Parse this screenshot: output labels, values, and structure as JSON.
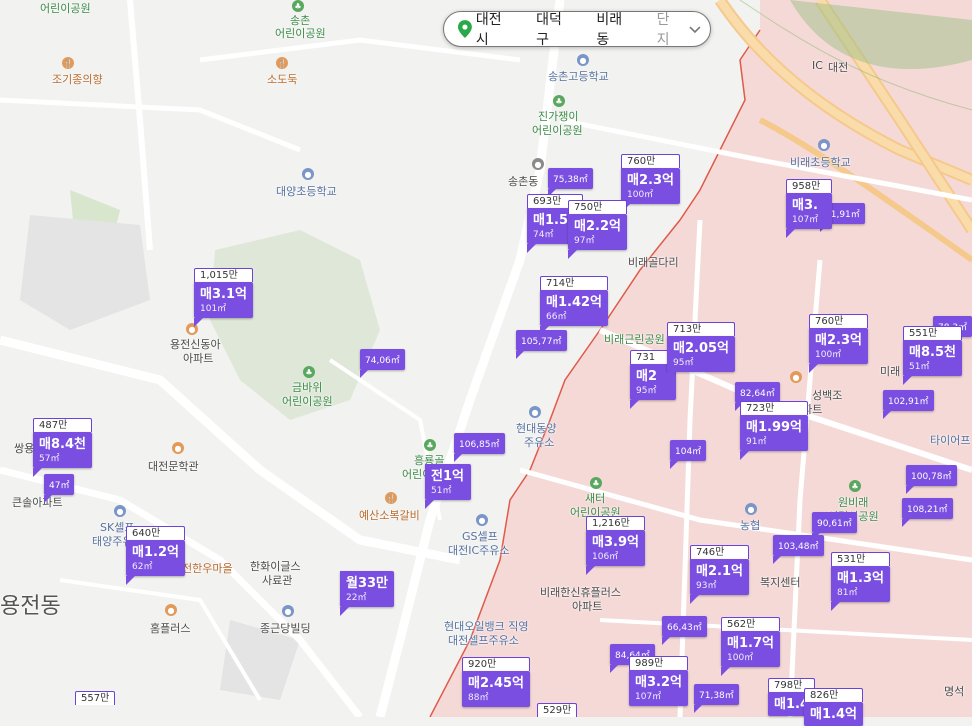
{
  "breadcrumb": {
    "city": "대전시",
    "district": "대덕구",
    "dong": "비래동",
    "complex_placeholder": "단지"
  },
  "places": {
    "p1": "어린이공원",
    "p2": "송촌",
    "p3": "어린이공원",
    "p4": "조기종의향",
    "p5": "소도둑",
    "p6": "송촌고등학교",
    "p7": "진가쟁이",
    "p8": "어린이공원",
    "p9": "대양초등학교",
    "p10": "송촌동",
    "p11": "비래초등학교",
    "p12": "대전",
    "p13": "용전신동아",
    "p14": "아파트",
    "p15": "금바위",
    "p16": "어린이공원",
    "p17": "대전문학관",
    "p18": "비래골다리",
    "p19": "비래근린공원",
    "p20": "현대동양",
    "p21": "주유소",
    "p22": "흥룡골",
    "p23": "어린이",
    "p24": "예산소복갈비",
    "p25": "GS셀프",
    "p26": "대전IC주유소",
    "p27": "새터",
    "p28": "어린이공원",
    "p29": "농협",
    "p30": "원비래",
    "p31": "어린이공원",
    "p32": "비래한신휴플러스",
    "p33": "아파트",
    "p34": "SK셀프",
    "p35": "태양주유소",
    "p36": "한화이글스",
    "p37": "사료관",
    "p38": "종근당빌딩",
    "p39": "홈플러스",
    "p40": "용전동",
    "p41": "현대오일뱅크 직영",
    "p42": "대전셀프주유소",
    "p43": "성백조",
    "p44": "아파트",
    "p45": "미래",
    "p46": "타이어프",
    "p47": "쌍용",
    "p48": "큰솔아파트",
    "p49": "복지센터",
    "p50": "명석",
    "p51": "전한우마을",
    "p52": "IC"
  },
  "listings": [
    {
      "top": "1,015만",
      "price": "매3.1억",
      "area": "101㎡"
    },
    {
      "top": "760만",
      "price": "매2.3억",
      "area": "100㎡"
    },
    {
      "top": "693만",
      "price": "매1.55",
      "area": "74㎡"
    },
    {
      "top": "750만",
      "price": "매2.2억",
      "area": "97㎡"
    },
    {
      "top": "714만",
      "price": "매1.42억",
      "area": "66㎡"
    },
    {
      "top": "958만",
      "price": "매3.",
      "area": "107㎡"
    },
    {
      "top": "713만",
      "price": "매2.05억",
      "area": "95㎡"
    },
    {
      "top": "731",
      "price": "매2",
      "area": "95㎡"
    },
    {
      "top": "760만",
      "price": "매2.3억",
      "area": "100㎡"
    },
    {
      "top": "551만",
      "price": "매8.5천",
      "area": "51㎡"
    },
    {
      "top": "723만",
      "price": "매1.99억",
      "area": "91㎡"
    },
    {
      "top": "487만",
      "price": "매8.4천",
      "area": "57㎡"
    },
    {
      "top": "",
      "price": "전1억",
      "area": "51㎡"
    },
    {
      "top": "640만",
      "price": "매1.2억",
      "area": "62㎡"
    },
    {
      "top": "",
      "price": "월33만",
      "area": "22㎡"
    },
    {
      "top": "1,216만",
      "price": "매3.9억",
      "area": "106㎡"
    },
    {
      "top": "746만",
      "price": "매2.1억",
      "area": "93㎡"
    },
    {
      "top": "531만",
      "price": "매1.3억",
      "area": "81㎡"
    },
    {
      "top": "562만",
      "price": "매1.7억",
      "area": "100㎡"
    },
    {
      "top": "920만",
      "price": "매2.45억",
      "area": "88㎡"
    },
    {
      "top": "989만",
      "price": "매3.2억",
      "area": "107㎡"
    },
    {
      "top": "798만",
      "price": "매1.4",
      "area": ""
    },
    {
      "top": "826만",
      "price": "매1.4억",
      "area": ""
    },
    {
      "top": "557만",
      "price": "",
      "area": ""
    },
    {
      "top": "529만",
      "price": "",
      "area": ""
    }
  ],
  "sizes": [
    "75,38㎡",
    "81,91㎡",
    "74,06㎡",
    "105,77㎡",
    "82,64㎡",
    "102,91㎡",
    "106,85㎡",
    "104㎡",
    "100,78㎡",
    "108,21㎡",
    "90,61㎡",
    "103,48㎡",
    "66,43㎡",
    "84,64㎡",
    "71,38㎡",
    "47㎡",
    "78,3㎡"
  ]
}
